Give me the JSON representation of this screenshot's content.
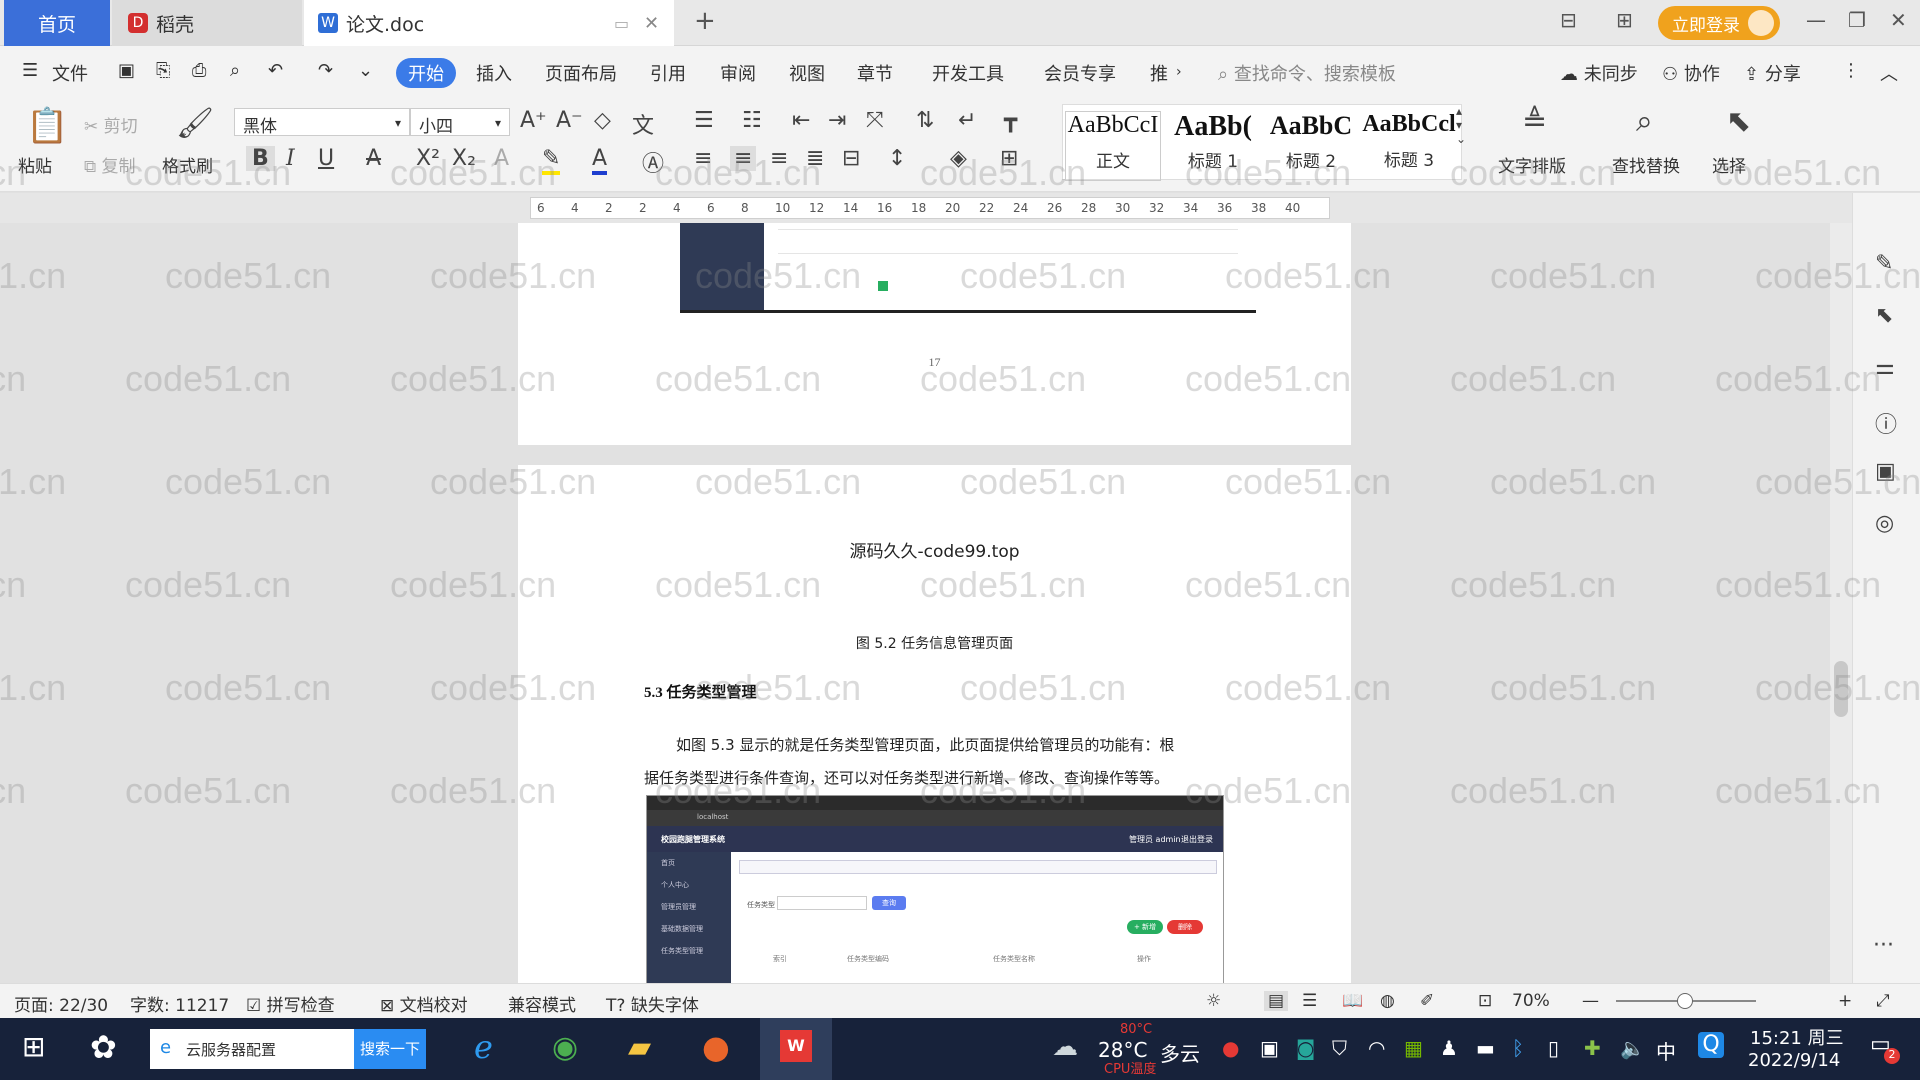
{
  "tabs": {
    "home": "首页",
    "daoke": "稻壳",
    "doc": "论文.doc",
    "new_tab": "+"
  },
  "titlebar": {
    "login": "立即登录"
  },
  "menu": {
    "file": "文件",
    "items": [
      "开始",
      "插入",
      "页面布局",
      "引用",
      "审阅",
      "视图",
      "章节",
      "开发工具",
      "会员专享",
      "推"
    ],
    "search_cmd": "查找命令、搜索模板",
    "unsynced": "未同步",
    "collab": "协作",
    "share": "分享"
  },
  "ribbon": {
    "paste": "粘贴",
    "cut": "剪切",
    "copy": "复制",
    "format_painter": "格式刷",
    "font_name": "黑体",
    "font_size": "小四",
    "styles": [
      {
        "preview": "AaBbCcI",
        "label": "正文"
      },
      {
        "preview": "AaBb(",
        "label": "标题 1"
      },
      {
        "preview": "AaBbC",
        "label": "标题 2"
      },
      {
        "preview": "AaBbCcl",
        "label": "标题 3"
      }
    ],
    "text_layout": "文字排版",
    "find_replace": "查找替换",
    "select": "选择"
  },
  "ruler": {
    "ticks": [
      "6",
      "4",
      "2",
      "2",
      "4",
      "6",
      "8",
      "10",
      "12",
      "14",
      "16",
      "18",
      "20",
      "22",
      "24",
      "26",
      "28",
      "30",
      "32",
      "34",
      "36",
      "38",
      "40"
    ]
  },
  "document": {
    "page_number": "17",
    "header_text": "源码久久-code99.top",
    "figure_caption": "图 5.2 任务信息管理页面",
    "section_heading": "5.3 任务类型管理",
    "paragraph_line1": "如图 5.3 显示的就是任务类型管理页面，此页面提供给管理员的功能有：根",
    "paragraph_line2": "据任务类型进行条件查询，还可以对任务类型进行新增、修改、查询操作等等。",
    "screenshot": {
      "app_title": "校园跑腿管理系统",
      "admin": "管理员 admin",
      "logout": "退出登录",
      "url": "localhost",
      "side_items": [
        "首页",
        "个人中心",
        "管理员管理",
        "基础数据管理",
        "任务类型管理"
      ],
      "search_label": "任务类型",
      "search_btn": "查询",
      "add_btn": "+ 新增",
      "del_btn": "删除",
      "col1": "索引",
      "col2": "任务类型编码",
      "col3": "任务类型名称",
      "col4": "操作"
    }
  },
  "watermark": "code51.cn",
  "statusbar": {
    "page": "页面: 22/30",
    "words": "字数: 11217",
    "spellcheck": "拼写检查",
    "proof": "文档校对",
    "compat": "兼容模式",
    "missing_font": "缺失字体",
    "zoom": "70%"
  },
  "taskbar": {
    "search_text": "云服务器配置",
    "search_btn": "搜索一下",
    "weather_temp": "28°C",
    "weather_desc": "多云",
    "cpu_temp": "80°C",
    "cpu_label": "CPU温度",
    "ime": "中",
    "time": "15:21 周三",
    "date": "2022/9/14",
    "notif_count": "2"
  }
}
